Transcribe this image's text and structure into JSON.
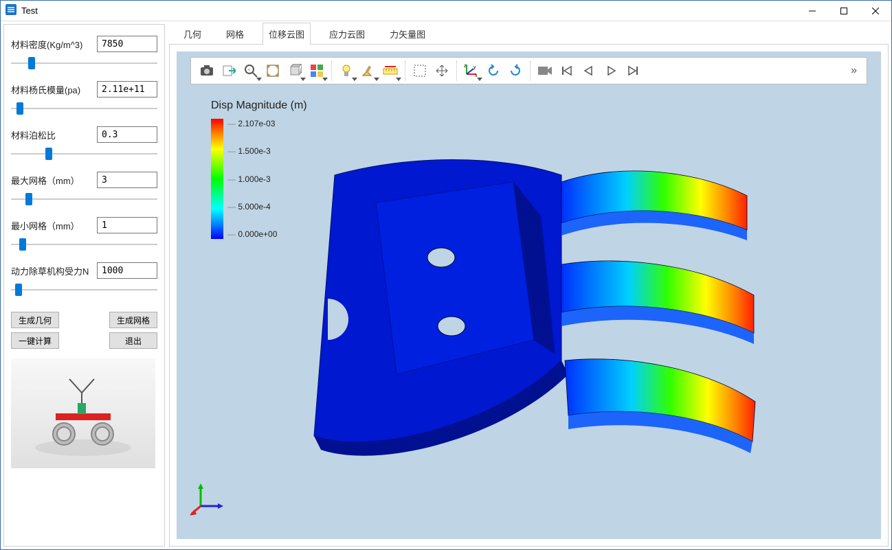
{
  "window": {
    "title": "Test"
  },
  "sidebar": {
    "params": {
      "density": {
        "label": "材料密度(Kg/m^3)",
        "value": "7850",
        "thumb_pct": 14
      },
      "youngs": {
        "label": "材料杨氏模量(pa)",
        "value": "2.11e+11",
        "thumb_pct": 6
      },
      "poisson": {
        "label": "材料泊松比",
        "value": "0.3",
        "thumb_pct": 26
      },
      "maxmesh": {
        "label": "最大网格（mm）",
        "value": "3",
        "thumb_pct": 12
      },
      "minmesh": {
        "label": "最小网格（mm）",
        "value": "1",
        "thumb_pct": 8
      },
      "force": {
        "label": "动力除草机构受力N",
        "value": "1000",
        "thumb_pct": 5
      }
    },
    "buttons": {
      "gen_geometry": "生成几何",
      "gen_mesh": "生成网格",
      "compute": "一键计算",
      "exit": "退出"
    }
  },
  "tabs": {
    "items": [
      {
        "label": "几何"
      },
      {
        "label": "网格"
      },
      {
        "label": "位移云图"
      },
      {
        "label": "应力云图"
      },
      {
        "label": "力矢量图"
      }
    ],
    "active_index": 2
  },
  "viewer": {
    "legend_title": "Disp Magnitude (m)",
    "legend_ticks": [
      "2.107e-03",
      "1.500e-3",
      "1.000e-3",
      "5.000e-4",
      "0.000e+00"
    ]
  },
  "chart_data": {
    "type": "heatmap",
    "title": "Disp Magnitude (m)",
    "colormap": "jet",
    "range": [
      0.0,
      0.002107
    ],
    "ticks": [
      0.0,
      0.0005,
      0.001,
      0.0015,
      0.002107
    ],
    "unit": "m",
    "description": "FEA displacement magnitude contour plot of a bracket component; fixed region (deep blue, ~0 displacement) on left mounting face and three cantilever fingers increasing to max (~2.107e-03 m, red/orange) at right tips."
  }
}
